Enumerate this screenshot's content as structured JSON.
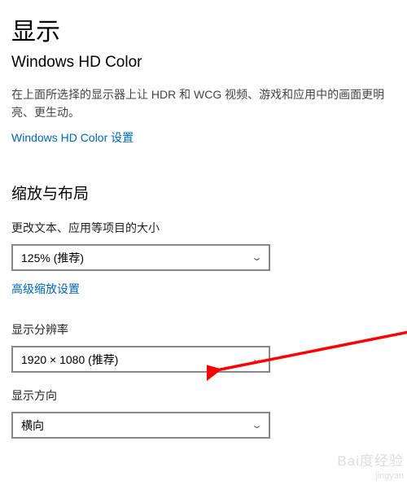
{
  "title": "显示",
  "subtitle": "Windows HD Color",
  "description": "在上面所选择的显示器上让 HDR 和 WCG 视频、游戏和应用中的画面更明亮、更生动。",
  "hd_color_link": "Windows HD Color 设置",
  "scale_section": {
    "title": "缩放与布局",
    "size_label": "更改文本、应用等项目的大小",
    "size_value": "125% (推荐)",
    "advanced_link": "高级缩放设置",
    "resolution_label": "显示分辨率",
    "resolution_value": "1920 × 1080 (推荐)",
    "orientation_label": "显示方向",
    "orientation_value": "横向"
  },
  "watermark": {
    "brand": "Bai度经验",
    "sub": "jingyan"
  }
}
